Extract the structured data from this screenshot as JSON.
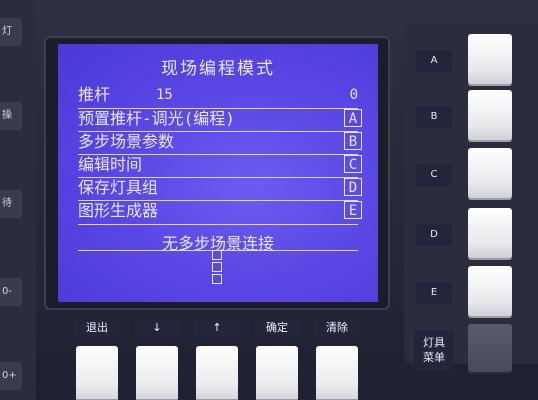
{
  "left_buttons": [
    {
      "label": "灯"
    },
    {
      "label": "操"
    },
    {
      "label": "待"
    },
    {
      "label": "0-"
    },
    {
      "label": "0+"
    }
  ],
  "screen": {
    "title": "现场编程模式",
    "fader_label": "推杆",
    "fader_value": "15",
    "fader_right": "0",
    "rows": [
      {
        "text": "预置推杆-调光(编程)",
        "tag": "A"
      },
      {
        "text": "多步场景参数",
        "tag": "B"
      },
      {
        "text": "编辑时间",
        "tag": "C"
      },
      {
        "text": "保存灯具组",
        "tag": "D"
      },
      {
        "text": "图形生成器",
        "tag": "E"
      }
    ],
    "status": "无多步场景连接"
  },
  "function_keys": [
    {
      "label": "A"
    },
    {
      "label": "B"
    },
    {
      "label": "C"
    },
    {
      "label": "D"
    },
    {
      "label": "E"
    }
  ],
  "fixture_menu": {
    "label_line1": "灯具",
    "label_line2": "菜单"
  },
  "bottom_keys": [
    {
      "label": "退出"
    },
    {
      "label": "↓"
    },
    {
      "label": "↑"
    },
    {
      "label": "确定"
    },
    {
      "label": "清除"
    }
  ]
}
